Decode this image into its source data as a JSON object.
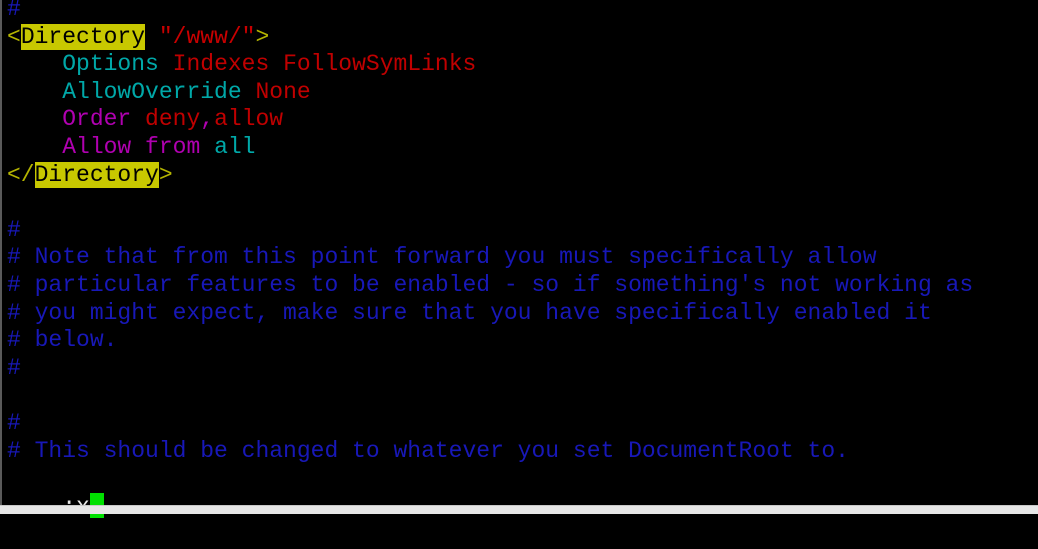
{
  "editor": {
    "colors": {
      "comment": "#1818b8",
      "keyword": "#00a8a8",
      "value": "#c00000",
      "magenta": "#b000b0",
      "search_highlight": "#c8c800",
      "cursor": "#00e000"
    },
    "lines": [
      [
        {
          "t": "#",
          "c": "comment"
        }
      ],
      [
        {
          "t": "<",
          "c": "tag"
        },
        {
          "t": "Directory",
          "c": "tagname"
        },
        {
          "t": " ",
          "c": "tag"
        },
        {
          "t": "\"/www/\"",
          "c": "string"
        },
        {
          "t": ">",
          "c": "tag"
        }
      ],
      [
        {
          "t": "    ",
          "c": "keyword"
        },
        {
          "t": "Options",
          "c": "keyword"
        },
        {
          "t": " ",
          "c": "keyword"
        },
        {
          "t": "Indexes FollowSymLinks",
          "c": "value"
        }
      ],
      [
        {
          "t": "    ",
          "c": "keyword"
        },
        {
          "t": "AllowOverride",
          "c": "keyword"
        },
        {
          "t": " ",
          "c": "keyword"
        },
        {
          "t": "None",
          "c": "value"
        }
      ],
      [
        {
          "t": "    ",
          "c": "magenta"
        },
        {
          "t": "Order",
          "c": "magenta"
        },
        {
          "t": " ",
          "c": "magenta"
        },
        {
          "t": "deny",
          "c": "value"
        },
        {
          "t": ",",
          "c": "magenta"
        },
        {
          "t": "allow",
          "c": "value"
        }
      ],
      [
        {
          "t": "    ",
          "c": "magenta"
        },
        {
          "t": "Allow",
          "c": "magenta"
        },
        {
          "t": " ",
          "c": "magenta"
        },
        {
          "t": "from",
          "c": "magenta"
        },
        {
          "t": " ",
          "c": "magenta"
        },
        {
          "t": "all",
          "c": "keyword"
        }
      ],
      [
        {
          "t": "</",
          "c": "tag"
        },
        {
          "t": "Directory",
          "c": "tagname"
        },
        {
          "t": ">",
          "c": "tag"
        }
      ],
      [],
      [
        {
          "t": "#",
          "c": "comment"
        }
      ],
      [
        {
          "t": "# Note that from this point forward you must specifically allow",
          "c": "comment"
        }
      ],
      [
        {
          "t": "# particular features to be enabled - so if something's not working as",
          "c": "comment"
        }
      ],
      [
        {
          "t": "# you might expect, make sure that you have specifically enabled it",
          "c": "comment"
        }
      ],
      [
        {
          "t": "# below.",
          "c": "comment"
        }
      ],
      [
        {
          "t": "#",
          "c": "comment"
        }
      ],
      [],
      [
        {
          "t": "#",
          "c": "comment"
        }
      ],
      [
        {
          "t": "# This should be changed to whatever you set DocumentRoot to.",
          "c": "comment"
        }
      ]
    ],
    "command_line": ":x"
  }
}
